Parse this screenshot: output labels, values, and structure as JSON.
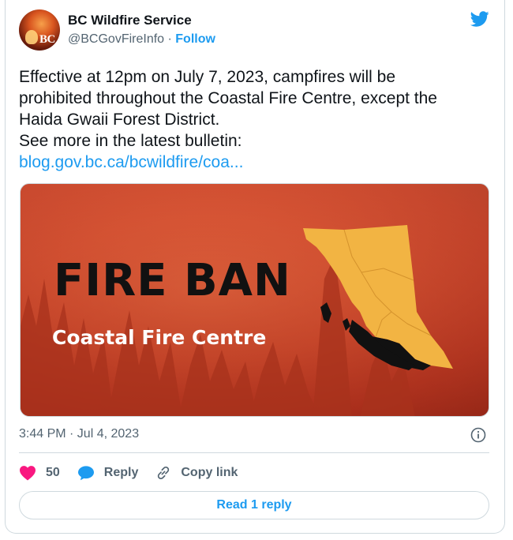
{
  "author": {
    "name": "BC Wildfire Service",
    "handle": "@BCGovFireInfo",
    "separator": " · ",
    "follow_label": "Follow",
    "avatar_text": "BC"
  },
  "tweet": {
    "lines": [
      "Effective at 12pm on July 7, 2023, campfires will be",
      "prohibited throughout the Coastal Fire Centre, except the",
      "Haida Gwaii Forest District.",
      "See more in the latest bulletin:"
    ],
    "link_text": "blog.gov.bc.ca/bcwildfire/coa..."
  },
  "media": {
    "headline": "FIRE BAN",
    "subheadline": "Coastal Fire Centre",
    "background_color": "#d24a2c",
    "map_color": "#f2b443",
    "highlight_color": "#111111"
  },
  "timestamp": "3:44 PM · Jul 4, 2023",
  "actions": {
    "likes_count": "50",
    "reply_label": "Reply",
    "copy_link_label": "Copy link"
  },
  "read_reply_label": "Read 1 reply",
  "icons": {
    "brand": "twitter-bird-icon",
    "like": "heart-icon",
    "reply": "speech-bubble-icon",
    "copy": "link-icon",
    "info": "info-icon"
  },
  "colors": {
    "accent": "#1d9bf0",
    "like": "#f91880",
    "muted_text": "#536471"
  }
}
